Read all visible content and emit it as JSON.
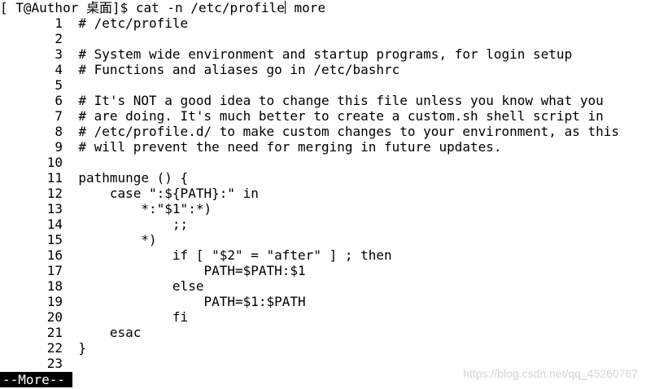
{
  "terminal": {
    "prompt": "[ T@Author 桌面]$ ",
    "command_before_cursor": "cat -n /etc/profile",
    "command_after_cursor": " more",
    "lines": [
      "       1  # /etc/profile",
      "       2",
      "       3  # System wide environment and startup programs, for login setup",
      "       4  # Functions and aliases go in /etc/bashrc",
      "       5",
      "       6  # It's NOT a good idea to change this file unless you know what you",
      "       7  # are doing. It's much better to create a custom.sh shell script in",
      "       8  # /etc/profile.d/ to make custom changes to your environment, as this",
      "       9  # will prevent the need for merging in future updates.",
      "      10",
      "      11  pathmunge () {",
      "      12      case \":${PATH}:\" in",
      "      13          *:\"$1\":*)",
      "      14              ;;",
      "      15          *)",
      "      16              if [ \"$2\" = \"after\" ] ; then",
      "      17                  PATH=$PATH:$1",
      "      18              else",
      "      19                  PATH=$1:$PATH",
      "      20              fi",
      "      21      esac",
      "      22  }",
      "      23"
    ],
    "more_status": "--More--",
    "watermark": "https://blog.csdn.net/qq_45260767"
  }
}
